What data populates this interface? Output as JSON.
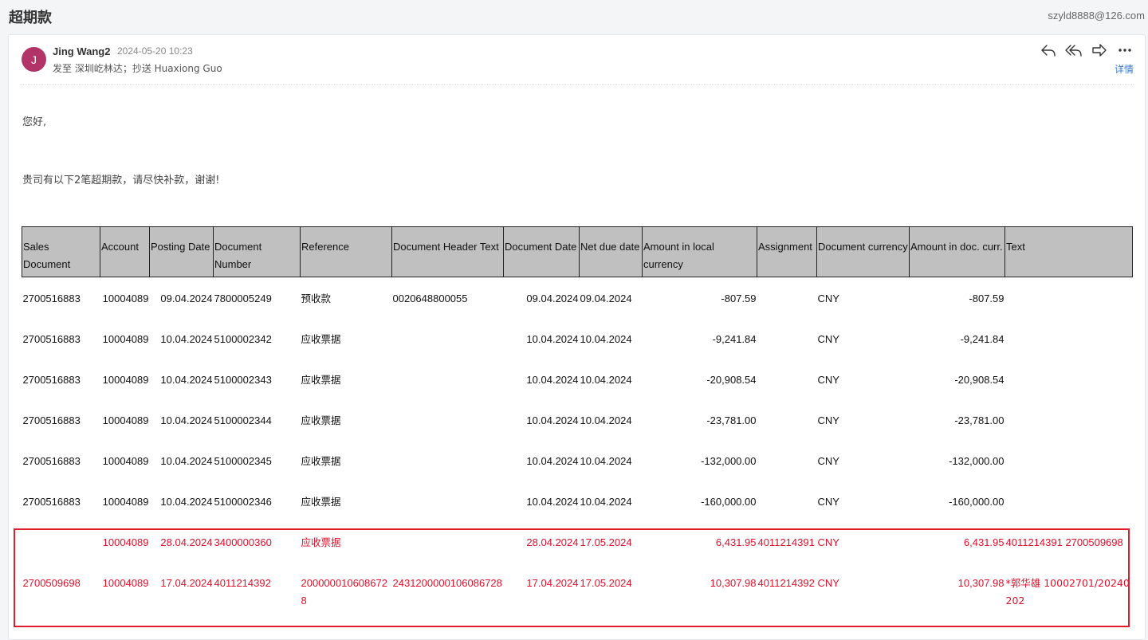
{
  "subject": "超期款",
  "account": "szyld8888@126.com",
  "email": {
    "avatar_letter": "J",
    "sender": "Jing Wang2",
    "date": "2024-05-20 10:23",
    "recipients": "发至 深圳屹林达；抄送 Huaxiong Guo",
    "details_label": "详情",
    "greeting": "您好,",
    "body": "贵司有以下2笔超期款，请尽快补款，谢谢!"
  },
  "icons": [
    "reply-icon",
    "reply-all-icon",
    "forward-icon",
    "more-icon"
  ],
  "table": {
    "headers": [
      "Sales Document",
      "Account",
      "Posting Date",
      "Document Number",
      "Reference",
      "Document Header Text",
      "Document Date",
      "Net due date",
      "Amount in local currency",
      "Assignment",
      "Document currency",
      "Amount in doc. curr.",
      "Text"
    ],
    "rows": [
      [
        "2700516883",
        "10004089",
        "09.04.2024",
        "7800005249",
        "预收款",
        "0020648800055",
        "09.04.2024",
        "09.04.2024",
        "-807.59",
        "",
        "CNY",
        "-807.59",
        ""
      ],
      [
        "2700516883",
        "10004089",
        "10.04.2024",
        "5100002342",
        "应收票据",
        "",
        "10.04.2024",
        "10.04.2024",
        "-9,241.84",
        "",
        "CNY",
        "-9,241.84",
        ""
      ],
      [
        "2700516883",
        "10004089",
        "10.04.2024",
        "5100002343",
        "应收票据",
        "",
        "10.04.2024",
        "10.04.2024",
        "-20,908.54",
        "",
        "CNY",
        "-20,908.54",
        ""
      ],
      [
        "2700516883",
        "10004089",
        "10.04.2024",
        "5100002344",
        "应收票据",
        "",
        "10.04.2024",
        "10.04.2024",
        "-23,781.00",
        "",
        "CNY",
        "-23,781.00",
        ""
      ],
      [
        "2700516883",
        "10004089",
        "10.04.2024",
        "5100002345",
        "应收票据",
        "",
        "10.04.2024",
        "10.04.2024",
        "-132,000.00",
        "",
        "CNY",
        "-132,000.00",
        ""
      ],
      [
        "2700516883",
        "10004089",
        "10.04.2024",
        "5100002346",
        "应收票据",
        "",
        "10.04.2024",
        "10.04.2024",
        "-160,000.00",
        "",
        "CNY",
        "-160,000.00",
        ""
      ],
      [
        "",
        "10004089",
        "28.04.2024",
        "3400000360",
        "应收票据",
        "",
        "28.04.2024",
        "17.05.2024",
        "6,431.95",
        "4011214391",
        "CNY",
        "6,431.95",
        "4011214391 2700509698"
      ],
      [
        "2700509698",
        "10004089",
        "17.04.2024",
        "4011214392",
        "2000000106086728",
        "2431200000106086728",
        "17.04.2024",
        "17.05.2024",
        "10,307.98",
        "4011214392",
        "CNY",
        "10,307.98",
        "*郭华雄 10002701/20240202"
      ]
    ],
    "highlight_color": "#e01d2c",
    "highlight_text_color": "#e0102b"
  }
}
